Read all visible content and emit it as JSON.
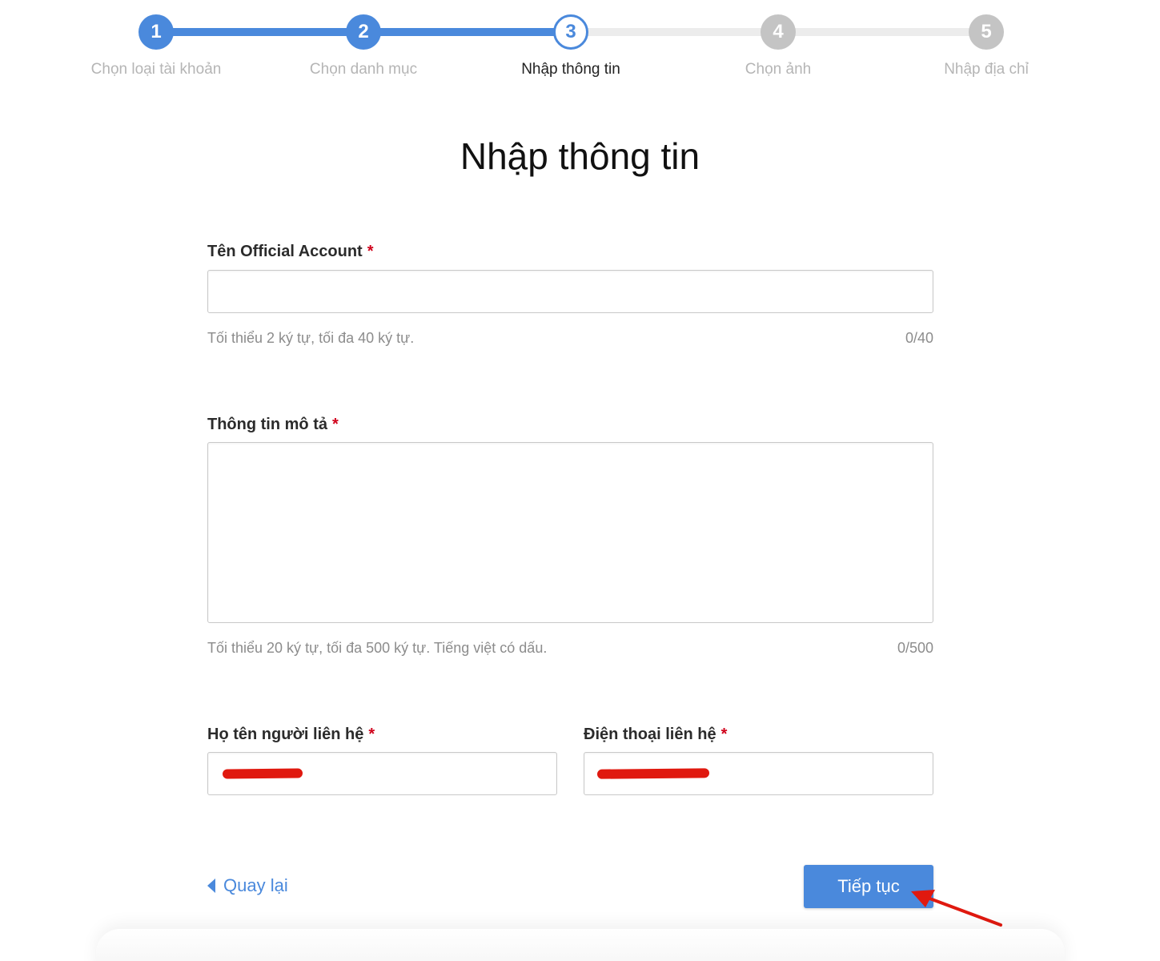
{
  "stepper": {
    "steps": [
      {
        "number": "1",
        "label": "Chọn loại tài khoản",
        "state": "done"
      },
      {
        "number": "2",
        "label": "Chọn danh mục",
        "state": "done"
      },
      {
        "number": "3",
        "label": "Nhập thông tin",
        "state": "active"
      },
      {
        "number": "4",
        "label": "Chọn ảnh",
        "state": "todo"
      },
      {
        "number": "5",
        "label": "Nhập địa chỉ",
        "state": "todo"
      }
    ]
  },
  "page": {
    "title": "Nhập thông tin"
  },
  "form": {
    "required_mark": "*",
    "oa_name": {
      "label": "Tên Official Account",
      "value": "",
      "helper": "Tối thiểu 2 ký tự, tối đa 40 ký tự.",
      "counter": "0/40"
    },
    "description": {
      "label": "Thông tin mô tả",
      "value": "",
      "helper": "Tối thiểu 20 ký tự, tối đa 500 ký tự. Tiếng việt có dấu.",
      "counter": "0/500"
    },
    "contact_name": {
      "label": "Họ tên người liên hệ"
    },
    "contact_phone": {
      "label": "Điện thoại liên hệ"
    }
  },
  "actions": {
    "back_label": "Quay lại",
    "next_label": "Tiếp tục"
  },
  "colors": {
    "primary": "#4a89dc",
    "required": "#d0021b",
    "annotation": "#e0190f",
    "inactive_step": "#c4c4c4"
  }
}
